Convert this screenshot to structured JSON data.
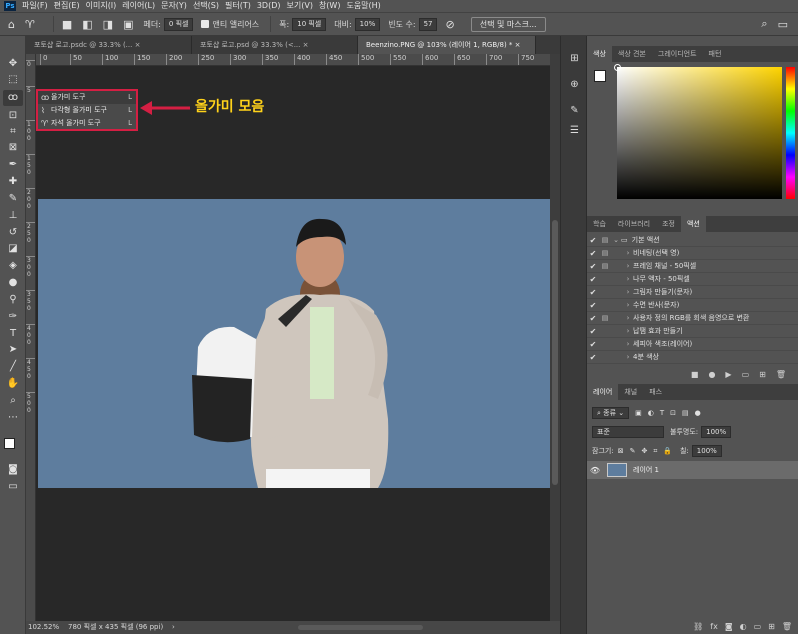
{
  "menubar": {
    "app_logo": "Ps",
    "items": [
      "파일(F)",
      "편집(E)",
      "이미지(I)",
      "레이어(L)",
      "문자(Y)",
      "선택(S)",
      "필터(T)",
      "3D(D)",
      "보기(V)",
      "창(W)",
      "도움말(H)"
    ]
  },
  "options": {
    "feather_label": "페더:",
    "feather_value": "0 픽셀",
    "antialias_label": "앤티 앨리어스",
    "width_label": "폭:",
    "width_value": "10 픽셀",
    "contrast_label": "대비:",
    "contrast_value": "10%",
    "frequency_label": "빈도 수:",
    "frequency_value": "57",
    "select_mask_label": "선택 및 마스크..."
  },
  "tabs": [
    {
      "label": "포토샵 로고.psdc @ 33.3% (..."
    },
    {
      "label": "포토샵 로고.psd @ 33.3% (<..."
    },
    {
      "label": "Beenzino.PNG @ 103% (레이어 1, RGB/8) *"
    }
  ],
  "ruler": {
    "h_ticks": [
      "0",
      "50",
      "100",
      "150",
      "200",
      "250",
      "300",
      "350",
      "400",
      "450",
      "500",
      "550",
      "600",
      "650",
      "700",
      "750"
    ],
    "v_ticks": [
      "0",
      "5",
      "1 0 0",
      "1 5 0",
      "2 0 0",
      "2 5 0",
      "3 0 0",
      "3 5 0",
      "4 0 0",
      "4 5 0",
      "5 0 0"
    ]
  },
  "flyout": {
    "items": [
      {
        "label": "올가미 도구",
        "shortcut": "L"
      },
      {
        "label": "다각형 올가미 도구",
        "shortcut": "L"
      },
      {
        "label": "자석 올가미 도구",
        "shortcut": "L"
      }
    ],
    "callout": "올가미 모음"
  },
  "status": {
    "zoom": "102.52%",
    "doc_info": "780 픽셀 x 435 픽셀 (96 ppi)"
  },
  "color_panel": {
    "tabs": [
      "색상",
      "색상 견본",
      "그레이디언트",
      "패턴"
    ],
    "accent": "#ffd400"
  },
  "actions_panel": {
    "tabs": [
      "학습",
      "라이브러리",
      "조정",
      "액션"
    ],
    "group": "기본 액션",
    "items": [
      "비네팅(선택 영)",
      "프레임 채널 - 50픽셀",
      "나무 액자 - 50픽셀",
      "그림자 만들기(문자)",
      "수면 반사(문자)",
      "사용자 정의 RGB를 회색 음영으로 변환",
      "납땜 효과 만들기",
      "세피아 색조(레이어)",
      "4분 색상"
    ]
  },
  "layers_panel": {
    "tabs": [
      "레이어",
      "채널",
      "패스"
    ],
    "filter": "종류",
    "blend_mode": "표준",
    "opacity_label": "불투명도:",
    "opacity_value": "100%",
    "lock_label": "잠그기:",
    "fill_label": "칠:",
    "fill_value": "100%",
    "layer_name": "레이어 1"
  }
}
